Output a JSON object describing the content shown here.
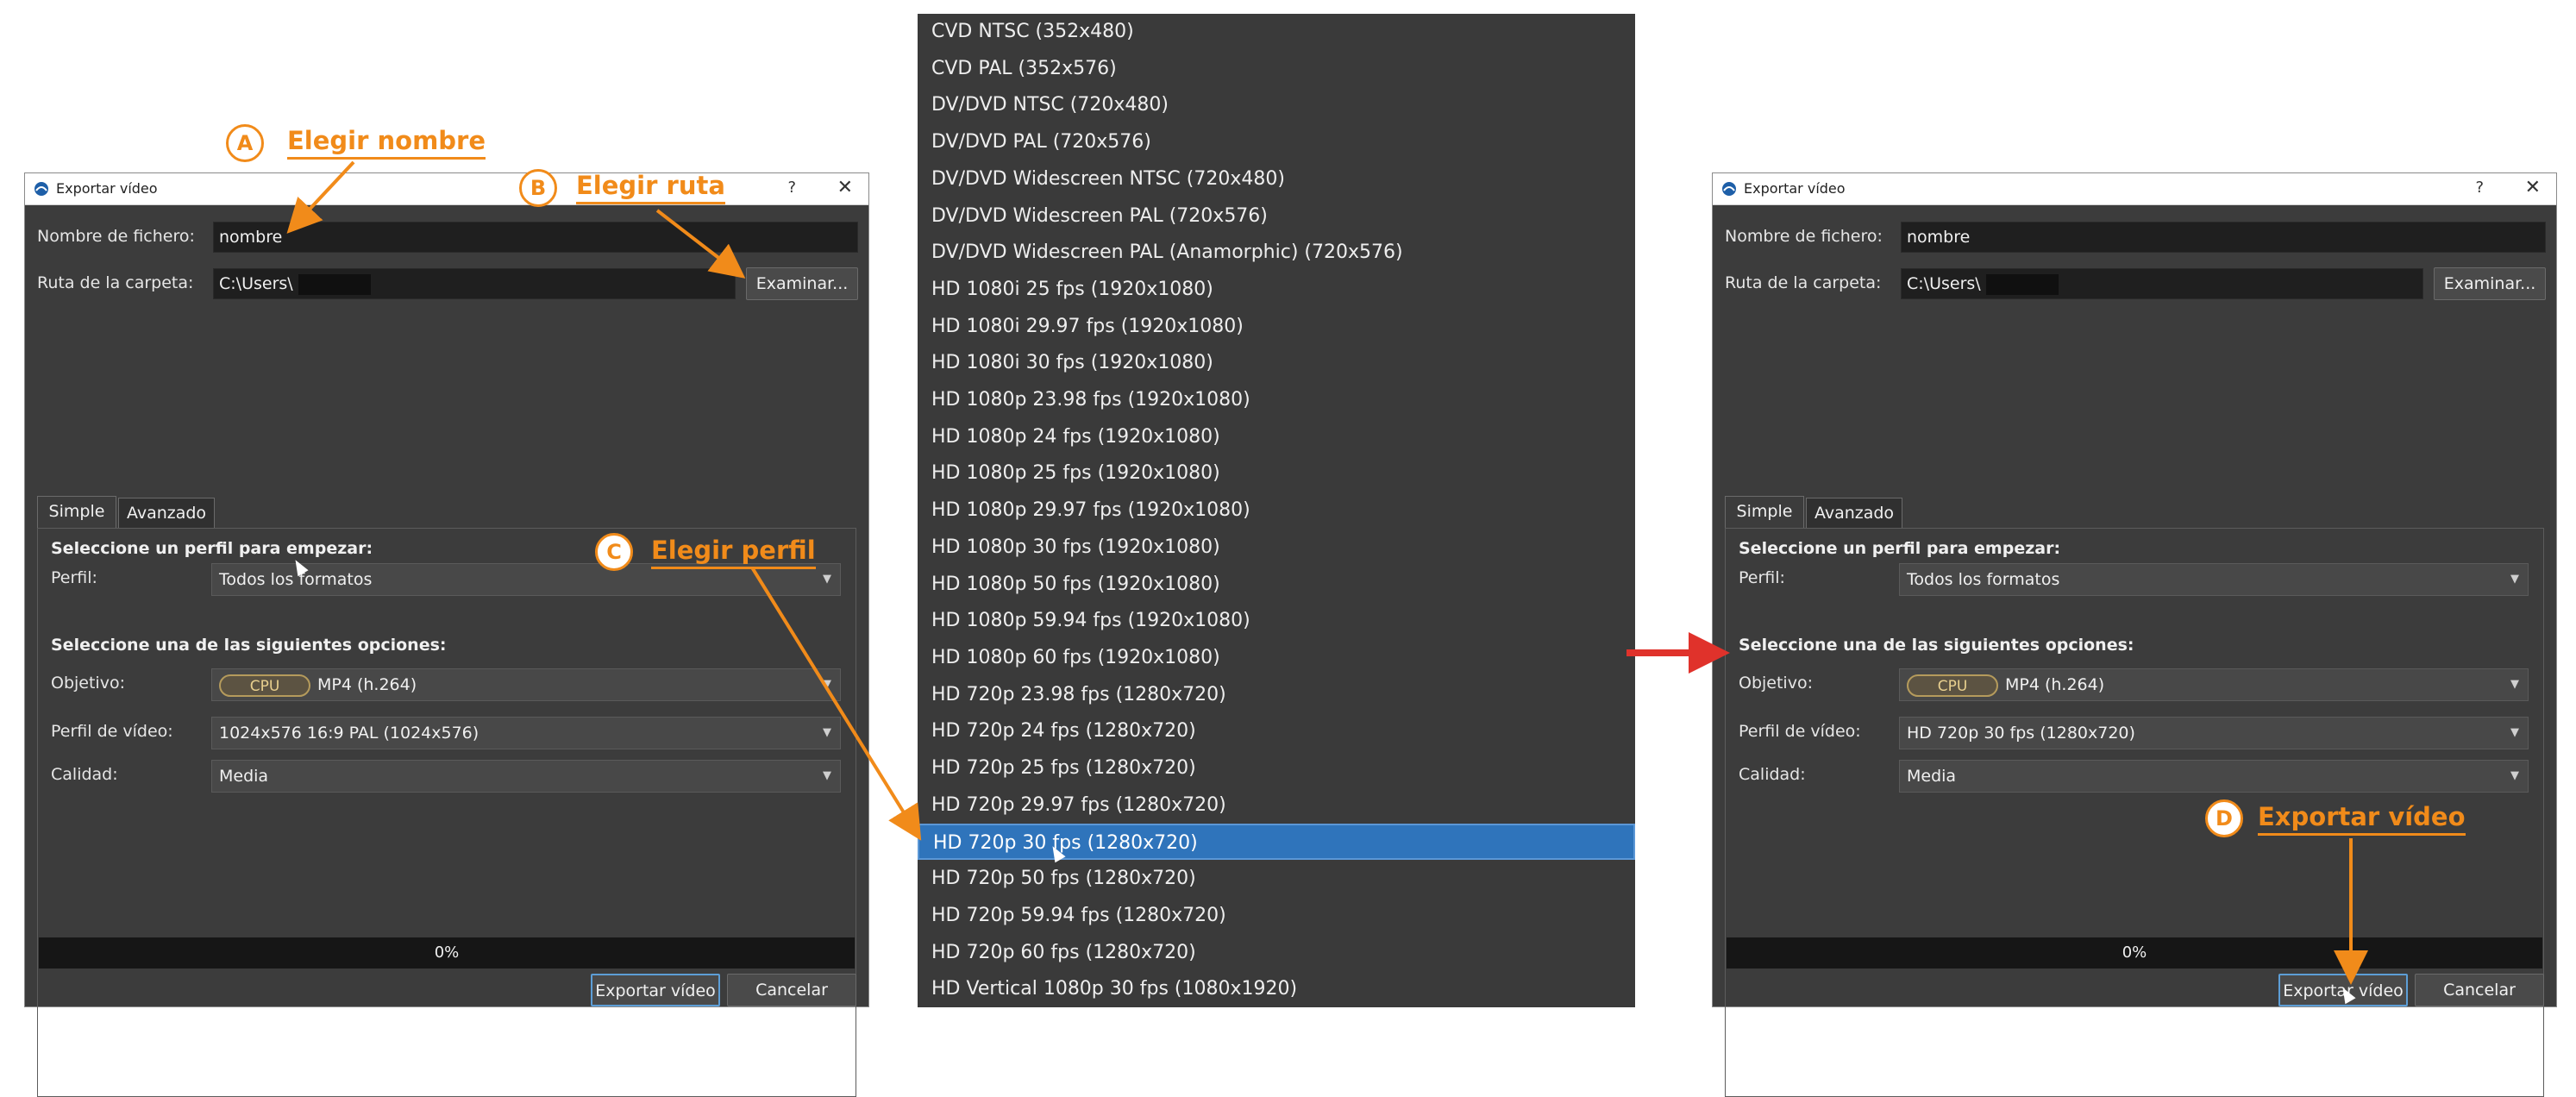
{
  "dialog": {
    "title": "Exportar vídeo",
    "help": "?",
    "close": "✕",
    "filename_label": "Nombre de fichero:",
    "filename_value": "nombre",
    "folder_label": "Ruta de la carpeta:",
    "folder_value": "C:\\Users\\",
    "browse_button": "Examinar...",
    "tabs": [
      "Simple",
      "Avanzado"
    ],
    "profile_section": "Seleccione un perfil para empezar:",
    "profile_label": "Perfil:",
    "profile_value": "Todos los formatos",
    "options_section": "Seleccione una de las siguientes opciones:",
    "target_label": "Objetivo:",
    "cpu_badge": "CPU",
    "target_value": "MP4 (h.264)",
    "video_profile_label": "Perfil de vídeo:",
    "quality_label": "Calidad:",
    "quality_value": "Media",
    "progress": "0%",
    "export_button": "Exportar vídeo",
    "cancel_button": "Cancelar"
  },
  "left": {
    "video_profile_value": "1024x576 16:9 PAL (1024x576)"
  },
  "right": {
    "video_profile_value": "HD 720p 30 fps (1280x720)"
  },
  "profile_list": {
    "items": [
      "CVD NTSC (352x480)",
      "CVD PAL (352x576)",
      "DV/DVD NTSC (720x480)",
      "DV/DVD PAL (720x576)",
      "DV/DVD Widescreen NTSC (720x480)",
      "DV/DVD Widescreen PAL (720x576)",
      "DV/DVD Widescreen PAL (Anamorphic) (720x576)",
      "HD 1080i 25 fps (1920x1080)",
      "HD 1080i 29.97 fps (1920x1080)",
      "HD 1080i 30 fps (1920x1080)",
      "HD 1080p 23.98 fps (1920x1080)",
      "HD 1080p 24 fps (1920x1080)",
      "HD 1080p 25 fps (1920x1080)",
      "HD 1080p 29.97 fps (1920x1080)",
      "HD 1080p 30 fps (1920x1080)",
      "HD 1080p 50 fps (1920x1080)",
      "HD 1080p 59.94 fps (1920x1080)",
      "HD 1080p 60 fps (1920x1080)",
      "HD 720p 23.98 fps (1280x720)",
      "HD 720p 24 fps (1280x720)",
      "HD 720p 25 fps (1280x720)",
      "HD 720p 29.97 fps (1280x720)",
      "HD 720p 30 fps (1280x720)",
      "HD 720p 50 fps (1280x720)",
      "HD 720p 59.94 fps (1280x720)",
      "HD 720p 60 fps (1280x720)",
      "HD Vertical 1080p 30 fps (1080x1920)"
    ],
    "selected": "HD 720p 30 fps (1280x720)"
  },
  "annotations": {
    "a_letter": "A",
    "a_text": "Elegir nombre",
    "b_letter": "B",
    "b_text": "Elegir ruta",
    "c_letter": "C",
    "c_text": "Elegir perfil",
    "d_letter": "D",
    "d_text": "Exportar vídeo"
  },
  "colors": {
    "annotation": "#f18b1a",
    "flow_arrow": "#e0322b",
    "selection": "#2f74bb",
    "dialog_bg": "#3c3c3c"
  }
}
